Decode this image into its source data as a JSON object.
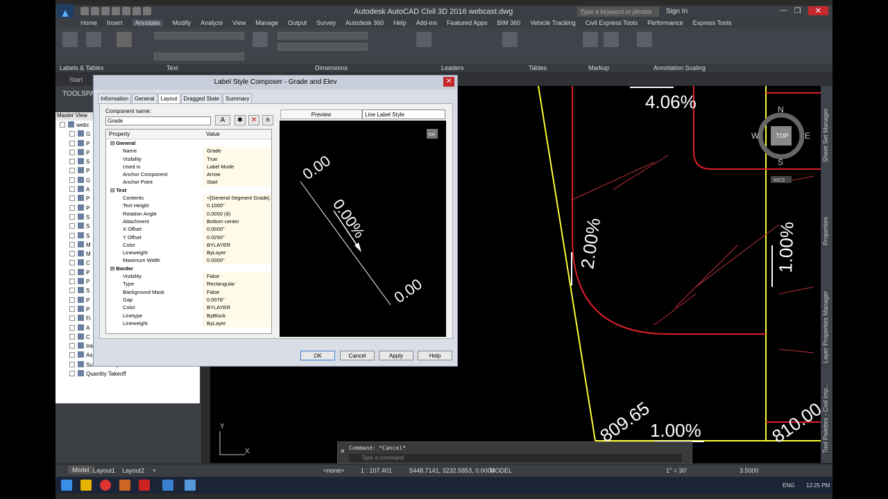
{
  "window": {
    "title": "Autodesk AutoCAD Civil 3D 2016   webcast.dwg",
    "search_placeholder": "Type a keyword or phrase",
    "sign_in": "Sign In"
  },
  "menu": [
    "Home",
    "Insert",
    "Annotate",
    "Modify",
    "Analyze",
    "View",
    "Manage",
    "Output",
    "Survey",
    "Autodesk 360",
    "Help",
    "Add-ins",
    "Featured Apps",
    "BIM 360",
    "Vehicle Tracking",
    "Civil Express Tools",
    "Performance",
    "Express Tools"
  ],
  "menu_active": "Annotate",
  "ribbon_panels": [
    "Labels & Tables",
    "Text",
    "Dimensions",
    "Leaders",
    "Tables",
    "Markup",
    "Annotation Scaling"
  ],
  "toolspace_label": "TOOLSPA",
  "start_tab": "Start",
  "tree": {
    "header": "Master View",
    "root": "webc",
    "items": [
      "G",
      "P",
      "P",
      "S",
      "P",
      "G",
      "A",
      "P",
      "P",
      "S",
      "S",
      "S",
      "M",
      "M",
      "C",
      "P",
      "P",
      "S",
      "P",
      "P",
      "Fi",
      "A",
      "C",
      "Intersection",
      "Assembly",
      "Subassembly",
      "Quantity Takeoff"
    ]
  },
  "dialog": {
    "title": "Label Style Composer - Grade and Elev",
    "tabs": [
      "Information",
      "General",
      "Layout",
      "Dragged State",
      "Summary"
    ],
    "active_tab": "Layout",
    "component_label": "Component name:",
    "component_value": "Grade",
    "grid_headers": [
      "Property",
      "Value"
    ],
    "rows": [
      {
        "cat": "General"
      },
      {
        "p": "Name",
        "v": "Grade"
      },
      {
        "p": "Visibility",
        "v": "True"
      },
      {
        "p": "Used in",
        "v": "Label Mode"
      },
      {
        "p": "Anchor Component",
        "v": "Arrow"
      },
      {
        "p": "Anchor Point",
        "v": "Start"
      },
      {
        "cat": "Text"
      },
      {
        "p": "Contents",
        "v": "<[General Segment Grade(..."
      },
      {
        "p": "Text Height",
        "v": "0.1000\""
      },
      {
        "p": "Rotation Angle",
        "v": "0.0000 (d)"
      },
      {
        "p": "Attachment",
        "v": "Bottom center"
      },
      {
        "p": "X Offset",
        "v": "0.0000\""
      },
      {
        "p": "Y Offset",
        "v": "0.0250\""
      },
      {
        "p": "Color",
        "v": "BYLAYER"
      },
      {
        "p": "Lineweight",
        "v": "ByLayer"
      },
      {
        "p": "Maximum Width",
        "v": "0.0000\""
      },
      {
        "cat": "Border"
      },
      {
        "p": "Visibility",
        "v": "False"
      },
      {
        "p": "Type",
        "v": "Rectangular"
      },
      {
        "p": "Background Mask",
        "v": "False"
      },
      {
        "p": "Gap",
        "v": "0.0076\""
      },
      {
        "p": "Color",
        "v": "BYLAYER"
      },
      {
        "p": "Linetype",
        "v": "ByBlock"
      },
      {
        "p": "Lineweight",
        "v": "ByLayer"
      }
    ],
    "preview_label": "Preview",
    "preview_style": "Line Label Style",
    "preview_texts": [
      "0.00",
      "0.00%",
      "0.00"
    ],
    "preview_badge": "TOP",
    "buttons": [
      "OK",
      "Cancel",
      "Apply",
      "Help"
    ]
  },
  "drawing": {
    "labels": [
      "4.06%",
      "2.00%",
      "1.00%",
      "809.65",
      "1.00%",
      "810.00"
    ],
    "viewcube": {
      "n": "N",
      "s": "S",
      "e": "E",
      "w": "W",
      "top": "TOP",
      "wcs": "WCS"
    },
    "ucs": {
      "x": "X",
      "y": "Y"
    }
  },
  "side_palettes": [
    "Sheet Set Manager",
    "Properties",
    "Layer Properties Manager",
    "Tool Palettes - Civil Imp..."
  ],
  "command": {
    "history": "Command: *Cancel*",
    "placeholder": "Type a command"
  },
  "status": {
    "tabs": [
      "Model",
      "Layout1",
      "Layout2"
    ],
    "none": "<none>",
    "scale": "1 : 107.401",
    "coords": "5448.7141, 3232.5853, 0.0000",
    "model": "MODEL",
    "annoscale": "1\" = 30'",
    "lineweight": "3.5000"
  },
  "taskbar": {
    "lang": "ENG",
    "time": "12:25 PM"
  }
}
